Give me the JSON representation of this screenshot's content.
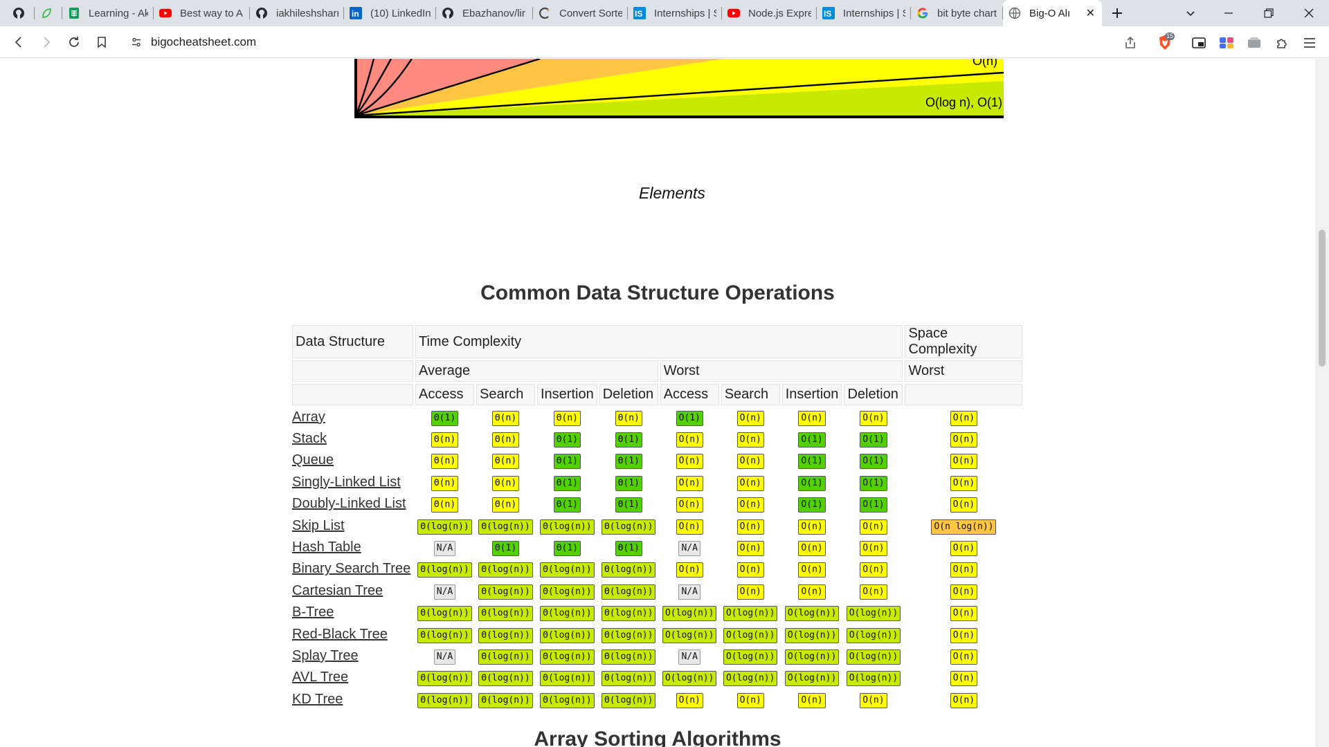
{
  "browser": {
    "tabs": [
      {
        "title": "",
        "icon": "github-icon"
      },
      {
        "title": "",
        "icon": "leaf-icon"
      },
      {
        "title": "Learning - Ak",
        "icon": "sheets-icon"
      },
      {
        "title": "Best way to A",
        "icon": "youtube-icon"
      },
      {
        "title": "iakhileshsharr",
        "icon": "github-icon"
      },
      {
        "title": "(10) LinkedIn",
        "icon": "linkedin-icon"
      },
      {
        "title": "Ebazhanov/lir",
        "icon": "github-icon"
      },
      {
        "title": "Convert Sorte",
        "icon": "converter-icon"
      },
      {
        "title": "Internships | S",
        "icon": "internshala-icon"
      },
      {
        "title": "Node.js Expre",
        "icon": "youtube-icon"
      },
      {
        "title": "Internships | S",
        "icon": "internshala-icon"
      },
      {
        "title": "bit byte chart",
        "icon": "google-icon"
      },
      {
        "title": "Big-O Alı",
        "icon": "globe-icon",
        "active": true
      }
    ],
    "url": "bigocheatsheet.com",
    "brave_badge": "15"
  },
  "chart": {
    "labels": [
      "O(n)",
      "O(log n), O(1)"
    ],
    "xlabel": "Elements"
  },
  "page": {
    "section_title": "Common Data Structure Operations",
    "next_section_title": "Array Sorting Algorithms"
  },
  "colors": {
    "excellent": "#53d000",
    "good": "#c8ea00",
    "fair": "#ffff00",
    "bad": "#ffc543",
    "na": "#e8e8e8"
  },
  "table": {
    "h_data_structure": "Data Structure",
    "h_time": "Time Complexity",
    "h_space": "Space Complexity",
    "h_average": "Average",
    "h_worst": "Worst",
    "h_space_worst": "Worst",
    "cols": [
      "Access",
      "Search",
      "Insertion",
      "Deletion",
      "Access",
      "Search",
      "Insertion",
      "Deletion"
    ],
    "rows": [
      {
        "name": "Array",
        "cells": [
          [
            "Θ(1)",
            "green"
          ],
          [
            "Θ(n)",
            "yellow"
          ],
          [
            "Θ(n)",
            "yellow"
          ],
          [
            "Θ(n)",
            "yellow"
          ],
          [
            "O(1)",
            "green"
          ],
          [
            "O(n)",
            "yellow"
          ],
          [
            "O(n)",
            "yellow"
          ],
          [
            "O(n)",
            "yellow"
          ],
          [
            "O(n)",
            "yellow"
          ]
        ]
      },
      {
        "name": "Stack",
        "cells": [
          [
            "Θ(n)",
            "yellow"
          ],
          [
            "Θ(n)",
            "yellow"
          ],
          [
            "Θ(1)",
            "green"
          ],
          [
            "Θ(1)",
            "green"
          ],
          [
            "O(n)",
            "yellow"
          ],
          [
            "O(n)",
            "yellow"
          ],
          [
            "O(1)",
            "green"
          ],
          [
            "O(1)",
            "green"
          ],
          [
            "O(n)",
            "yellow"
          ]
        ]
      },
      {
        "name": "Queue",
        "cells": [
          [
            "Θ(n)",
            "yellow"
          ],
          [
            "Θ(n)",
            "yellow"
          ],
          [
            "Θ(1)",
            "green"
          ],
          [
            "Θ(1)",
            "green"
          ],
          [
            "O(n)",
            "yellow"
          ],
          [
            "O(n)",
            "yellow"
          ],
          [
            "O(1)",
            "green"
          ],
          [
            "O(1)",
            "green"
          ],
          [
            "O(n)",
            "yellow"
          ]
        ]
      },
      {
        "name": "Singly-Linked List",
        "cells": [
          [
            "Θ(n)",
            "yellow"
          ],
          [
            "Θ(n)",
            "yellow"
          ],
          [
            "Θ(1)",
            "green"
          ],
          [
            "Θ(1)",
            "green"
          ],
          [
            "O(n)",
            "yellow"
          ],
          [
            "O(n)",
            "yellow"
          ],
          [
            "O(1)",
            "green"
          ],
          [
            "O(1)",
            "green"
          ],
          [
            "O(n)",
            "yellow"
          ]
        ]
      },
      {
        "name": "Doubly-Linked List",
        "cells": [
          [
            "Θ(n)",
            "yellow"
          ],
          [
            "Θ(n)",
            "yellow"
          ],
          [
            "Θ(1)",
            "green"
          ],
          [
            "Θ(1)",
            "green"
          ],
          [
            "O(n)",
            "yellow"
          ],
          [
            "O(n)",
            "yellow"
          ],
          [
            "O(1)",
            "green"
          ],
          [
            "O(1)",
            "green"
          ],
          [
            "O(n)",
            "yellow"
          ]
        ]
      },
      {
        "name": "Skip List",
        "cells": [
          [
            "Θ(log(n))",
            "yg"
          ],
          [
            "Θ(log(n))",
            "yg"
          ],
          [
            "Θ(log(n))",
            "yg"
          ],
          [
            "Θ(log(n))",
            "yg"
          ],
          [
            "O(n)",
            "yellow"
          ],
          [
            "O(n)",
            "yellow"
          ],
          [
            "O(n)",
            "yellow"
          ],
          [
            "O(n)",
            "yellow"
          ],
          [
            "O(n log(n))",
            "orange"
          ]
        ]
      },
      {
        "name": "Hash Table",
        "cells": [
          [
            "N/A",
            "gray"
          ],
          [
            "Θ(1)",
            "green"
          ],
          [
            "Θ(1)",
            "green"
          ],
          [
            "Θ(1)",
            "green"
          ],
          [
            "N/A",
            "gray"
          ],
          [
            "O(n)",
            "yellow"
          ],
          [
            "O(n)",
            "yellow"
          ],
          [
            "O(n)",
            "yellow"
          ],
          [
            "O(n)",
            "yellow"
          ]
        ]
      },
      {
        "name": "Binary Search Tree",
        "cells": [
          [
            "Θ(log(n))",
            "yg"
          ],
          [
            "Θ(log(n))",
            "yg"
          ],
          [
            "Θ(log(n))",
            "yg"
          ],
          [
            "Θ(log(n))",
            "yg"
          ],
          [
            "O(n)",
            "yellow"
          ],
          [
            "O(n)",
            "yellow"
          ],
          [
            "O(n)",
            "yellow"
          ],
          [
            "O(n)",
            "yellow"
          ],
          [
            "O(n)",
            "yellow"
          ]
        ]
      },
      {
        "name": "Cartesian Tree",
        "cells": [
          [
            "N/A",
            "gray"
          ],
          [
            "Θ(log(n))",
            "yg"
          ],
          [
            "Θ(log(n))",
            "yg"
          ],
          [
            "Θ(log(n))",
            "yg"
          ],
          [
            "N/A",
            "gray"
          ],
          [
            "O(n)",
            "yellow"
          ],
          [
            "O(n)",
            "yellow"
          ],
          [
            "O(n)",
            "yellow"
          ],
          [
            "O(n)",
            "yellow"
          ]
        ]
      },
      {
        "name": "B-Tree",
        "cells": [
          [
            "Θ(log(n))",
            "yg"
          ],
          [
            "Θ(log(n))",
            "yg"
          ],
          [
            "Θ(log(n))",
            "yg"
          ],
          [
            "Θ(log(n))",
            "yg"
          ],
          [
            "O(log(n))",
            "yg"
          ],
          [
            "O(log(n))",
            "yg"
          ],
          [
            "O(log(n))",
            "yg"
          ],
          [
            "O(log(n))",
            "yg"
          ],
          [
            "O(n)",
            "yellow"
          ]
        ]
      },
      {
        "name": "Red-Black Tree",
        "cells": [
          [
            "Θ(log(n))",
            "yg"
          ],
          [
            "Θ(log(n))",
            "yg"
          ],
          [
            "Θ(log(n))",
            "yg"
          ],
          [
            "Θ(log(n))",
            "yg"
          ],
          [
            "O(log(n))",
            "yg"
          ],
          [
            "O(log(n))",
            "yg"
          ],
          [
            "O(log(n))",
            "yg"
          ],
          [
            "O(log(n))",
            "yg"
          ],
          [
            "O(n)",
            "yellow"
          ]
        ]
      },
      {
        "name": "Splay Tree",
        "cells": [
          [
            "N/A",
            "gray"
          ],
          [
            "Θ(log(n))",
            "yg"
          ],
          [
            "Θ(log(n))",
            "yg"
          ],
          [
            "Θ(log(n))",
            "yg"
          ],
          [
            "N/A",
            "gray"
          ],
          [
            "O(log(n))",
            "yg"
          ],
          [
            "O(log(n))",
            "yg"
          ],
          [
            "O(log(n))",
            "yg"
          ],
          [
            "O(n)",
            "yellow"
          ]
        ]
      },
      {
        "name": "AVL Tree",
        "cells": [
          [
            "Θ(log(n))",
            "yg"
          ],
          [
            "Θ(log(n))",
            "yg"
          ],
          [
            "Θ(log(n))",
            "yg"
          ],
          [
            "Θ(log(n))",
            "yg"
          ],
          [
            "O(log(n))",
            "yg"
          ],
          [
            "O(log(n))",
            "yg"
          ],
          [
            "O(log(n))",
            "yg"
          ],
          [
            "O(log(n))",
            "yg"
          ],
          [
            "O(n)",
            "yellow"
          ]
        ]
      },
      {
        "name": "KD Tree",
        "cells": [
          [
            "Θ(log(n))",
            "yg"
          ],
          [
            "Θ(log(n))",
            "yg"
          ],
          [
            "Θ(log(n))",
            "yg"
          ],
          [
            "Θ(log(n))",
            "yg"
          ],
          [
            "O(n)",
            "yellow"
          ],
          [
            "O(n)",
            "yellow"
          ],
          [
            "O(n)",
            "yellow"
          ],
          [
            "O(n)",
            "yellow"
          ],
          [
            "O(n)",
            "yellow"
          ]
        ]
      }
    ]
  }
}
